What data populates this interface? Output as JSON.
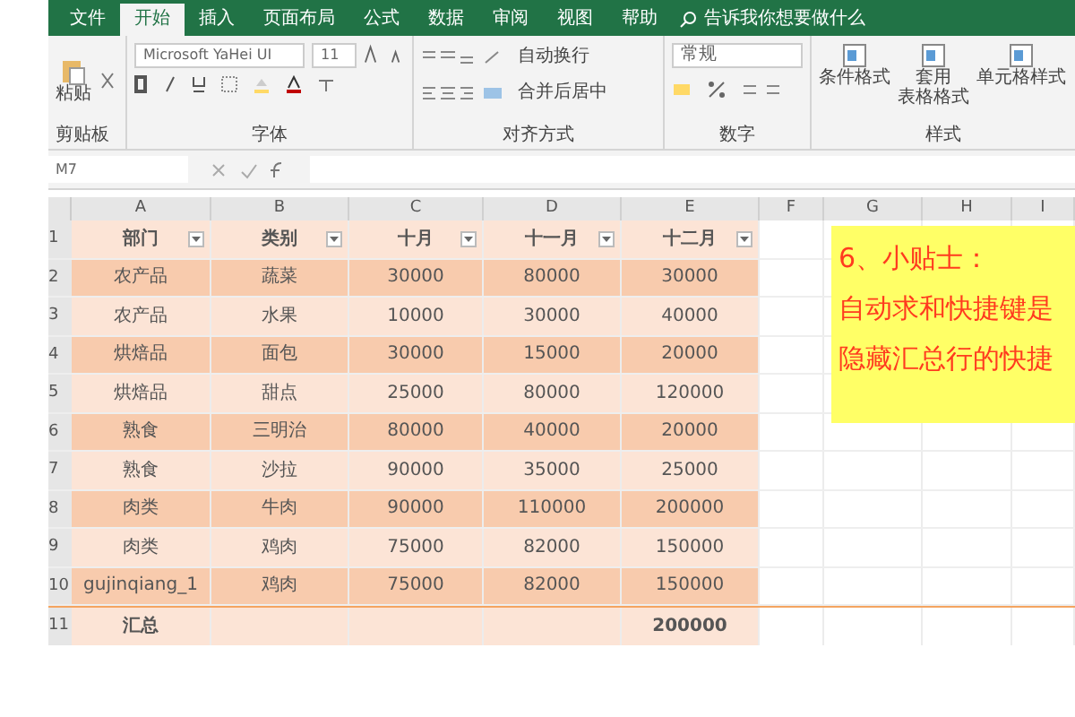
{
  "ribbon_tabs": [
    {
      "label": "文件",
      "selected": false
    },
    {
      "label": "开始",
      "selected": true
    },
    {
      "label": "插入",
      "selected": false
    },
    {
      "label": "页面布局",
      "selected": false
    },
    {
      "label": "公式",
      "selected": false
    },
    {
      "label": "数据",
      "selected": false
    },
    {
      "label": "审阅",
      "selected": false
    },
    {
      "label": "视图",
      "selected": false
    },
    {
      "label": "帮助",
      "selected": false
    }
  ],
  "search": {
    "placeholder": "告诉我你想要做什么"
  },
  "clipboard": {
    "paste": "粘贴",
    "label": "剪贴板"
  },
  "font": {
    "name": "Microsoft YaHei UI",
    "size": "11",
    "label": "字体"
  },
  "alignment": {
    "wrap": "自动换行",
    "merge": "合并后居中",
    "label": "对齐方式"
  },
  "number": {
    "format": "常规",
    "label": "数字"
  },
  "styles": {
    "buttons": [
      {
        "lines": [
          "条件格式"
        ]
      },
      {
        "lines": [
          "套用",
          "表格格式"
        ]
      },
      {
        "lines": [
          "单元格样式"
        ]
      }
    ],
    "label": "样式"
  },
  "name_box": "M7",
  "column_letters": [
    "A",
    "B",
    "C",
    "D",
    "E",
    "F",
    "G",
    "H",
    "I"
  ],
  "row_numbers": [
    "1",
    "2",
    "3",
    "4",
    "5",
    "6",
    "7",
    "8",
    "9",
    "10",
    "11"
  ],
  "table": {
    "columns": [
      "部门",
      "类别",
      "十月",
      "十一月",
      "十二月"
    ],
    "rows": [
      [
        "农产品",
        "蔬菜",
        "30000",
        "80000",
        "30000"
      ],
      [
        "农产品",
        "水果",
        "10000",
        "30000",
        "40000"
      ],
      [
        "烘焙品",
        "面包",
        "30000",
        "15000",
        "20000"
      ],
      [
        "烘焙品",
        "甜点",
        "25000",
        "80000",
        "120000"
      ],
      [
        "熟食",
        "三明治",
        "80000",
        "40000",
        "20000"
      ],
      [
        "熟食",
        "沙拉",
        "90000",
        "35000",
        "25000"
      ],
      [
        "肉类",
        "牛肉",
        "90000",
        "110000",
        "200000"
      ],
      [
        "肉类",
        "鸡肉",
        "75000",
        "82000",
        "150000"
      ],
      [
        "gujinqiang_1",
        "鸡肉",
        "75000",
        "82000",
        "150000"
      ]
    ],
    "total": {
      "label": "汇总",
      "value": "200000"
    }
  },
  "note": {
    "lines": [
      "6、小贴士：",
      "自动求和快捷键是",
      "隐藏汇总行的快捷"
    ]
  }
}
